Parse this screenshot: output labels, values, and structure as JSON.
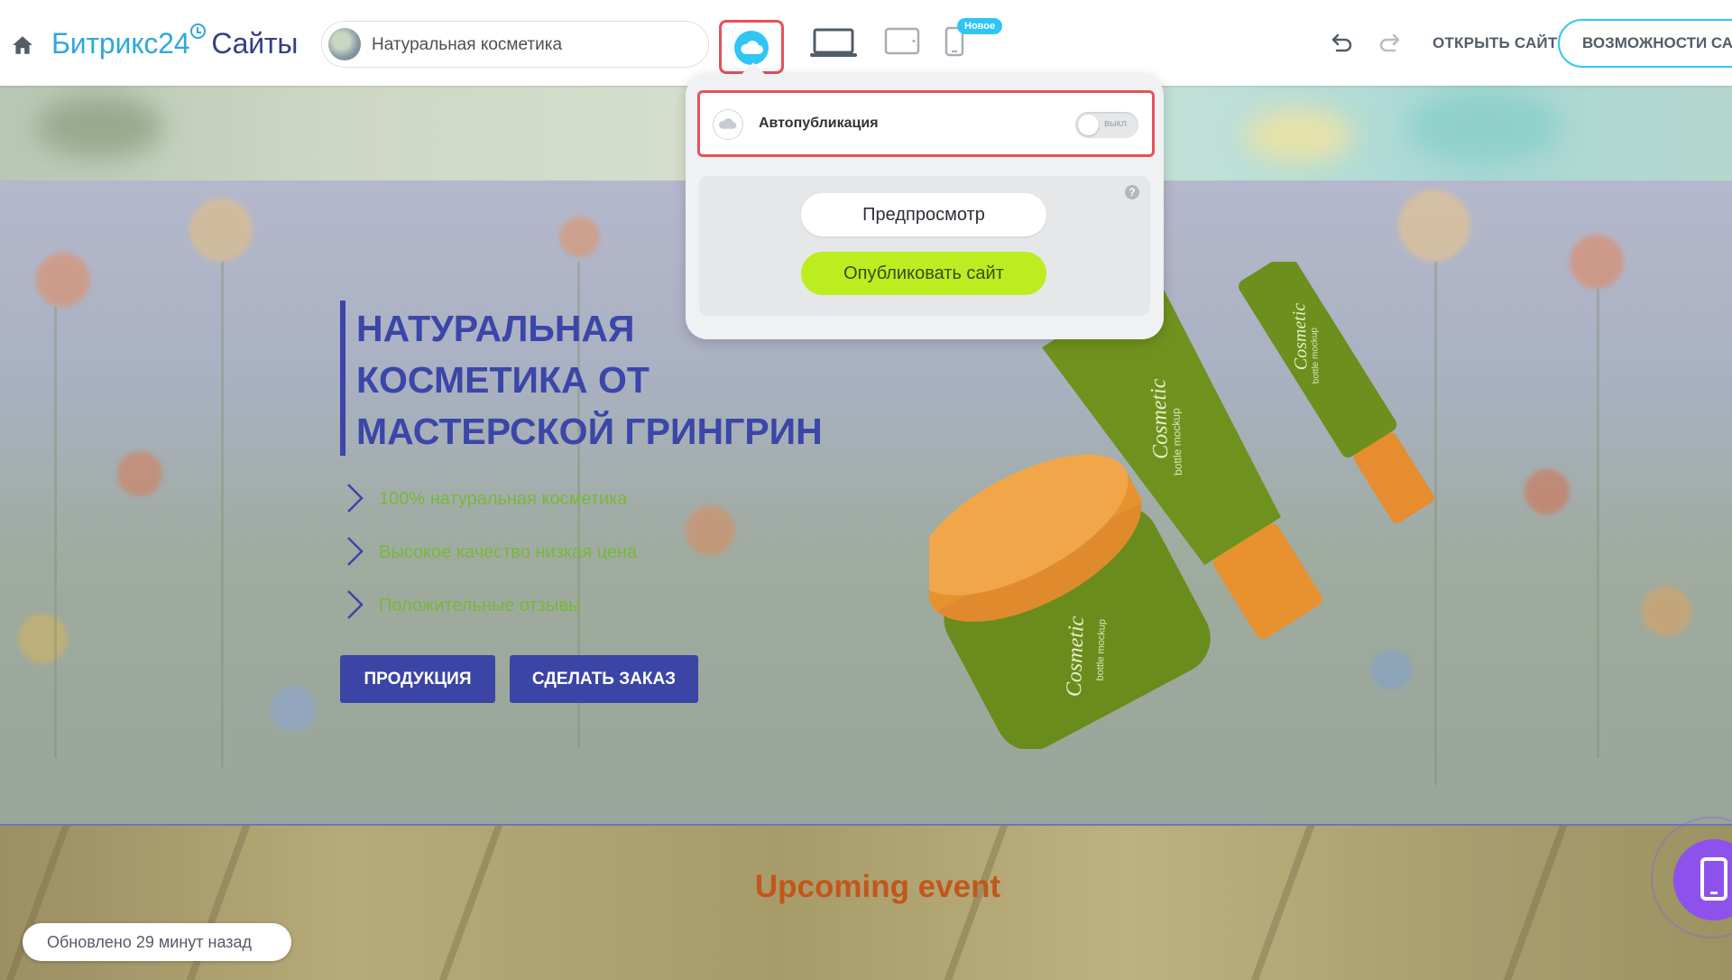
{
  "header": {
    "logo_brand": "Битрикс24",
    "logo_product": "Сайты",
    "site_name": "Натуральная косметика",
    "new_badge": "Новое",
    "open_site": "ОТКРЫТЬ САЙТ",
    "features": "ВОЗМОЖНОСТИ САЙТА"
  },
  "publish_popup": {
    "autopublish_label": "Автопубликация",
    "toggle_state": "выкл",
    "help_glyph": "?",
    "preview_button": "Предпросмотр",
    "publish_button": "Опубликовать сайт"
  },
  "hero": {
    "title_lines": [
      "НАТУРАЛЬНАЯ",
      "КОСМЕТИКА ОТ",
      "МАСТЕРСКОЙ ГРИНГРИН"
    ],
    "features": [
      "100% натуральная косметика",
      "Высокое качество низкая цена",
      "Положительные отзывы"
    ],
    "buttons": {
      "products": "ПРОДУКЦИЯ",
      "order": "СДЕЛАТЬ ЗАКАЗ"
    },
    "product_label": "Cosmetic",
    "product_sublabel": "bottle mockup"
  },
  "upcoming": {
    "title": "Upcoming event"
  },
  "status": {
    "updated": "Обновлено 29 минут назад"
  },
  "colors": {
    "accent_blue": "#2fc6f6",
    "brand_blue": "#2fa8dd",
    "hero_title": "#3b46a8",
    "publish_green": "#bbed21",
    "highlight_red": "#e8505b",
    "feature_green": "#78b83a",
    "event_orange": "#c2571a",
    "float_purple": "#8e52ec"
  },
  "icons": [
    "home-icon",
    "cloud-icon",
    "desktop-icon",
    "tablet-icon",
    "mobile-icon",
    "undo-icon",
    "redo-icon",
    "chevron-right-icon",
    "phone-icon"
  ]
}
